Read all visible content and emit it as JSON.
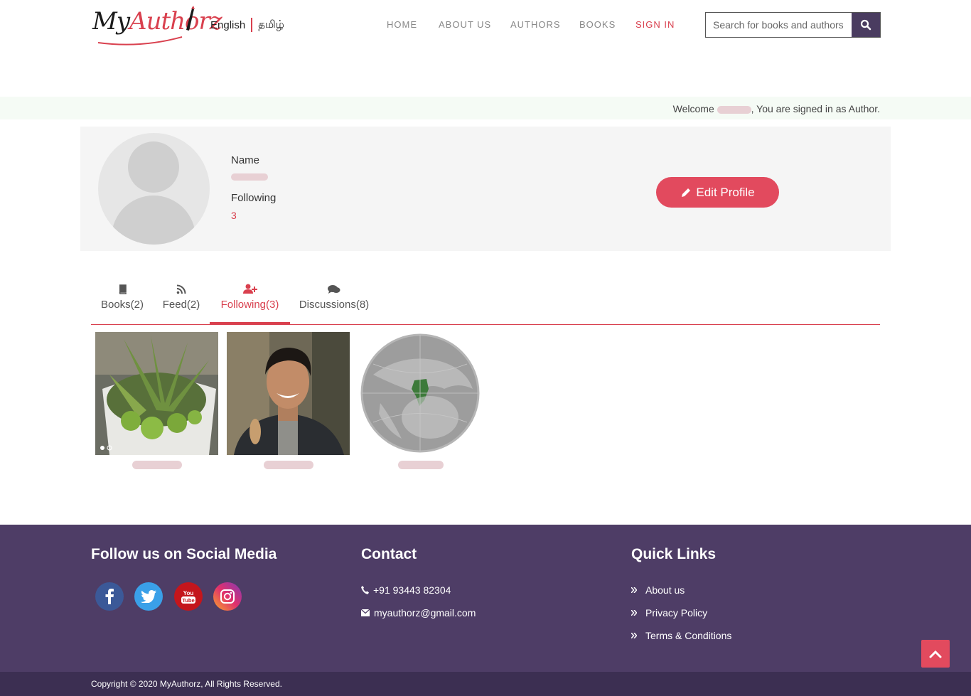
{
  "header": {
    "logo_text_1": "My",
    "logo_text_2": "Authorz",
    "lang_english": "English",
    "lang_tamil": "தமிழ்",
    "nav": [
      "HOME",
      "ABOUT US",
      "AUTHORS",
      "BOOKS",
      "SIGN IN"
    ],
    "search_placeholder": "Search for books and authors"
  },
  "welcome": {
    "prefix": "Welcome ",
    "suffix": ", You are signed in as Author."
  },
  "profile": {
    "name_label": "Name",
    "following_label": "Following",
    "following_count": "3",
    "edit_button": "Edit Profile"
  },
  "tabs": [
    {
      "label": "Books(2)",
      "icon": "book-icon"
    },
    {
      "label": "Feed(2)",
      "icon": "rss-icon"
    },
    {
      "label": "Following(3)",
      "icon": "user-plus-icon",
      "active": true
    },
    {
      "label": "Discussions(8)",
      "icon": "comments-icon"
    }
  ],
  "footer": {
    "social_title": "Follow us on Social Media",
    "contact_title": "Contact",
    "phone": "+91 93443 82304",
    "email": "myauthorz@gmail.com",
    "quick_links_title": "Quick Links",
    "links": [
      "About us",
      "Privacy Policy",
      "Terms & Conditions"
    ],
    "copyright": "Copyright © 2020 MyAuthorz, All Rights Reserved."
  },
  "colors": {
    "accent": "#d9404e",
    "footer_bg": "#4e3d66",
    "search_btn": "#4a3c60"
  }
}
